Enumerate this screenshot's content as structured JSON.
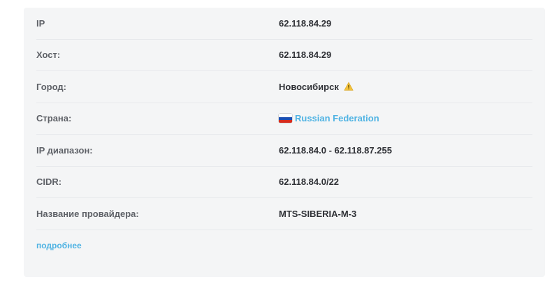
{
  "rows": [
    {
      "label": "IP",
      "value": "62.118.84.29"
    },
    {
      "label": "Хост:",
      "value": "62.118.84.29"
    },
    {
      "label": "Город:",
      "value": "Новосибирск"
    },
    {
      "label": "Страна:",
      "value": "Russian Federation"
    },
    {
      "label": "IP диапазон:",
      "value": "62.118.84.0 - 62.118.87.255"
    },
    {
      "label": "CIDR:",
      "value": "62.118.84.0/22"
    },
    {
      "label": "Название провайдера:",
      "value": "MTS-SIBERIA-M-3"
    }
  ],
  "icons": {
    "city_warning": "warning-icon",
    "country_flag": "russia-flag-icon"
  },
  "colors": {
    "link": "#4fb3e3",
    "card_bg": "#f4f5f6",
    "warning": "#f2c23c"
  },
  "more_link": "подробнее"
}
